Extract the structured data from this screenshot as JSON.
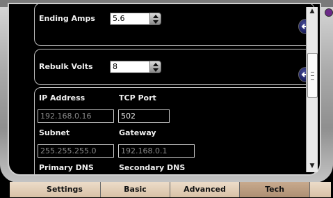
{
  "colors": {
    "frame": "#a9a9a9",
    "screen": "#000000",
    "accent": "#6b2a88",
    "tab_bg": "#d8c1a6",
    "tab_active": "#ad8f73"
  },
  "panels": {
    "ending_amps": {
      "label": "Ending Amps",
      "value": "5.6"
    },
    "rebulk_volts": {
      "label": "Rebulk Volts",
      "value": "8"
    }
  },
  "network": {
    "ip_address": {
      "label": "IP Address",
      "value": "192.168.0.16"
    },
    "tcp_port": {
      "label": "TCP Port",
      "value": "502"
    },
    "subnet": {
      "label": "Subnet",
      "value": "255.255.255.0"
    },
    "gateway": {
      "label": "Gateway",
      "value": "192.168.0.1"
    },
    "primary_dns": {
      "label": "Primary DNS"
    },
    "secondary_dns": {
      "label": "Secondary DNS"
    }
  },
  "tabs": [
    {
      "label": "Settings"
    },
    {
      "label": "Basic"
    },
    {
      "label": "Advanced"
    },
    {
      "label": "Tech",
      "active": true
    }
  ],
  "icons": [
    "enter-icon",
    "scroll-up-icon",
    "scroll-down-icon",
    "spin-up-icon",
    "spin-down-icon"
  ]
}
